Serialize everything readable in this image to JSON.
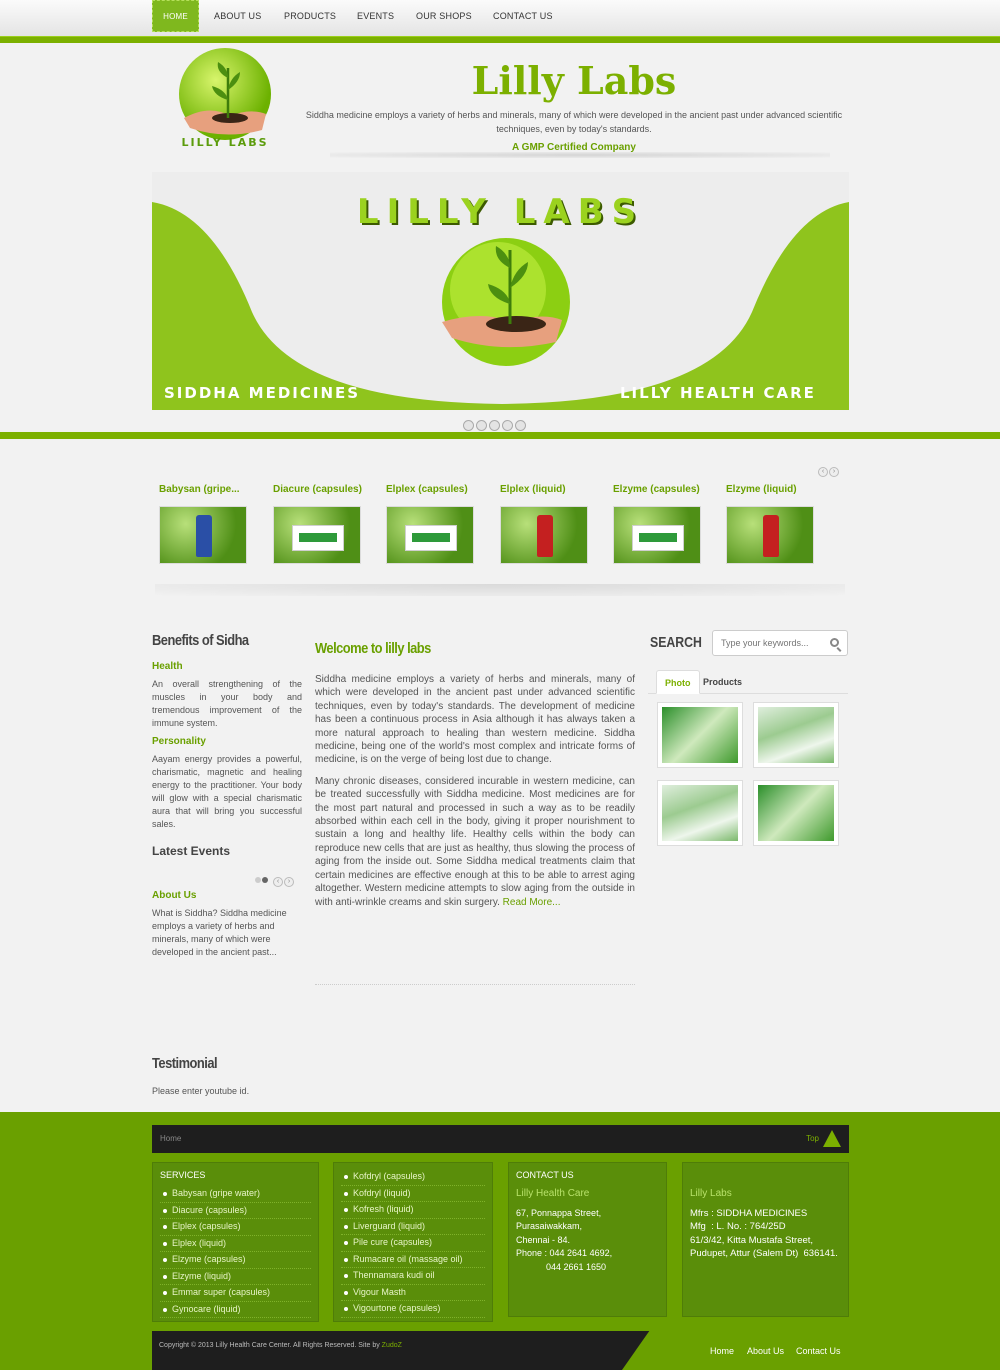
{
  "nav": {
    "items": [
      "HOME",
      "ABOUT US",
      "PRODUCTS",
      "EVENTS",
      "OUR SHOPS",
      "CONTACT US"
    ]
  },
  "header": {
    "logo_text": "LILLY LABS",
    "title": "Lilly Labs",
    "description": "Siddha medicine employs a variety of herbs and minerals, many of which were developed in the ancient past under advanced scientific techniques, even by today's standards.",
    "certification": "A GMP Certified Company"
  },
  "banner": {
    "title": "LILLY LABS",
    "left_caption": "SIDDHA MEDICINES",
    "right_caption": "LILLY HEALTH CARE",
    "slide_count": 5
  },
  "products": [
    {
      "name": "Babysan (gripe...",
      "icon": "bottle-blue"
    },
    {
      "name": "Diacure (capsules)",
      "icon": "box"
    },
    {
      "name": "Elplex (capsules)",
      "icon": "box"
    },
    {
      "name": "Elplex (liquid)",
      "icon": "bottle-red"
    },
    {
      "name": "Elzyme (capsules)",
      "icon": "box"
    },
    {
      "name": "Elzyme (liquid)",
      "icon": "bottle-red"
    }
  ],
  "left": {
    "benefits_title": "Benefits of Sidha",
    "health_title": "Health",
    "health_text": "An overall strengthening of the muscles in your body and tremendous improvement of the immune system.",
    "personality_title": "Personality",
    "personality_text": "Aayam energy provides a powerful, charismatic, magnetic and healing energy to the practitioner. Your body will glow with a special charismatic aura that will bring you successful sales.",
    "events_title": "Latest Events",
    "about_title": "About Us",
    "about_text": "What is Siddha? Siddha medicine employs a variety of herbs and minerals, many of which were developed in the ancient past..."
  },
  "center": {
    "welcome_title": "Welcome to lilly labs",
    "para1": "Siddha medicine employs a variety of herbs and minerals, many of which were developed in the ancient past under advanced scientific techniques, even by today's standards. The development of medicine has been a continuous process in Asia although it has always taken a more natural approach to healing than western medicine. Siddha medicine, being one of the world's most complex and intricate forms of medicine, is on the verge of being lost due to change.",
    "para2": "Many chronic diseases, considered incurable in western medicine, can be treated successfully with Siddha medicine. Most medicines are for the most part natural and processed in such a way as to be readily absorbed within each cell in the body, giving it proper nourishment to sustain a long and healthy life. Healthy cells within the body can reproduce new cells that are just as healthy, thus slowing the process of aging from the inside out. Some Siddha medical treatments claim that certain medicines are effective enough at this to be able to arrest aging altogether. Western medicine attempts to slow aging from the outside in with anti-wrinkle creams and skin surgery.",
    "read_more": "Read More..."
  },
  "right": {
    "search_label": "SEARCH",
    "search_placeholder": "Type your keywords...",
    "tabs": [
      "Photo",
      "Products"
    ]
  },
  "testimonial": {
    "title": "Testimonial",
    "text": "Please enter youtube id."
  },
  "footer": {
    "bar_home": "Home",
    "bar_top": "Top",
    "services_title": "SERVICES",
    "services": [
      "Babysan (gripe water)",
      "Diacure (capsules)",
      "Elplex (capsules)",
      "Elplex (liquid)",
      "Elzyme (capsules)",
      "Elzyme (liquid)",
      "Emmar super (capsules)",
      "Gynocare (liquid)"
    ],
    "services2": [
      "Kofdryl (capsules)",
      "Kofdryl (liquid)",
      "Kofresh (liquid)",
      "Liverguard (liquid)",
      "Pile cure (capsules)",
      "Rumacare oil (massage oil)",
      "Thennamara kudi oil",
      "Vigour Masth",
      "Vigourtone (capsules)"
    ],
    "contact_title": "CONTACT US",
    "contact_name": "Lilly Health Care",
    "contact_address": "67, Ponnappa Street,\nPurasaiwakkam,\nChennai - 84.\nPhone : 044 2641 4692,\n            044 2661 1650",
    "labs_name": "Lilly Labs",
    "labs_address": "Mfrs : SIDDHA MEDICINES\nMfg  : L. No. : 764/25D\n61/3/42, Kitta Mustafa Street,\nPudupet, Attur (Salem Dt)  636141.",
    "copyright": "Copyright © 2013 Lilly Health Care Center. All Rights Reserved. Site by",
    "site_by": "ZudoZ",
    "bottom_links": [
      "Home",
      "About Us",
      "Contact Us"
    ]
  }
}
